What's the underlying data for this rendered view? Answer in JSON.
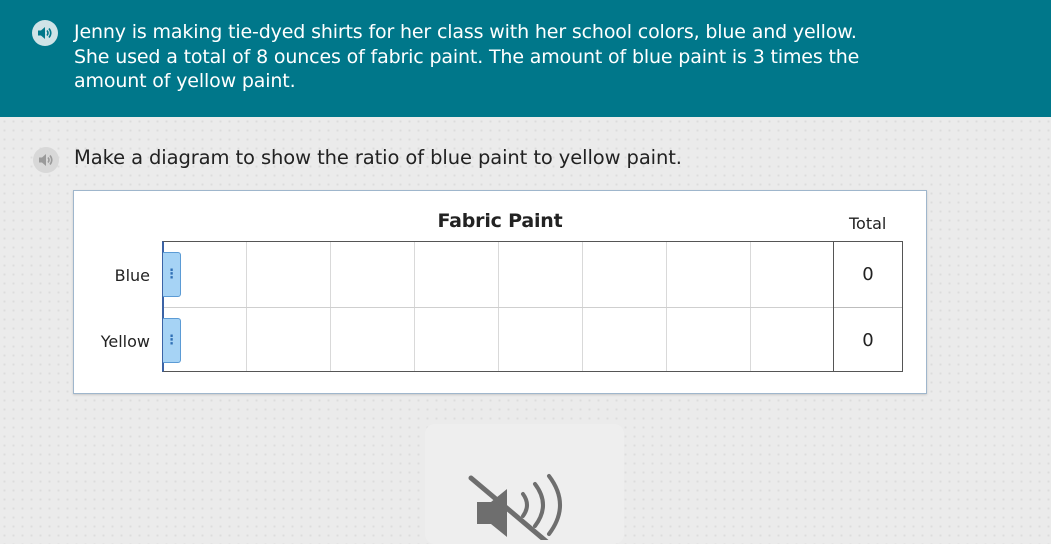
{
  "header": {
    "text": "Jenny is making tie-dyed shirts for her class with her school colors, blue and yellow. She used a total of 8 ounces of fabric paint. The amount of blue paint is 3 times the amount of yellow paint.",
    "speaker_icon": "speaker-icon"
  },
  "question": {
    "text": "Make a diagram to show the ratio of blue paint to yellow paint.",
    "speaker_icon": "speaker-icon"
  },
  "diagram": {
    "title": "Fabric Paint",
    "total_label": "Total",
    "rows": [
      {
        "label": "Blue",
        "total": "0",
        "filled_units": 0
      },
      {
        "label": "Yellow",
        "total": "0",
        "filled_units": 0
      }
    ],
    "grid_units": 8
  },
  "audio_card": {
    "icon": "muted-speaker-icon"
  },
  "colors": {
    "header_bg": "#00778a",
    "handle_fill": "#a6d3f5",
    "grid_left_border": "#3b63a6"
  }
}
